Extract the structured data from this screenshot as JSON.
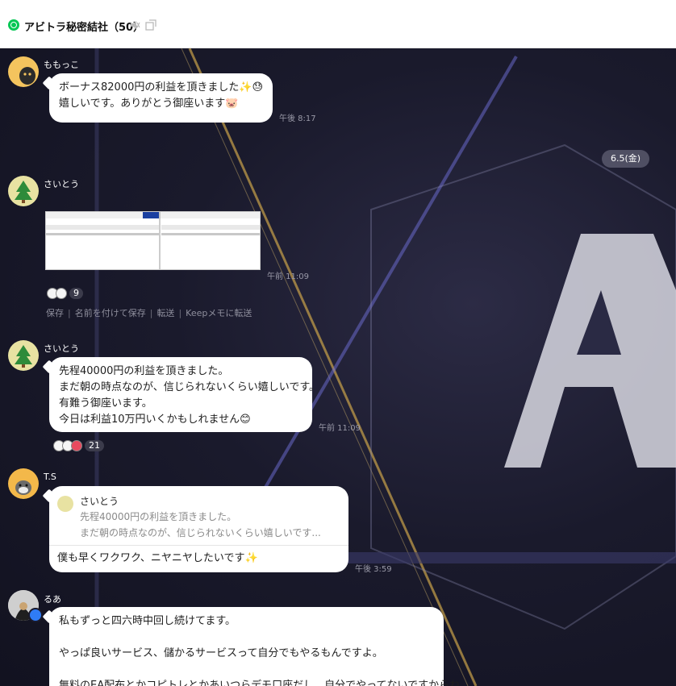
{
  "header": {
    "title": "アビトラ秘密結社（50）"
  },
  "date_separator": "6.5(金)",
  "messages": [
    {
      "sender": "ももっこ",
      "lines": [
        "ボーナス82000円の利益を頂きました✨😓",
        "嬉しいです。ありがとう御座います🐷"
      ],
      "time": "午後 8:17"
    },
    {
      "sender": "さいとう",
      "type": "image",
      "time": "午前 11:09",
      "reaction_count": "9",
      "actions": [
        "保存",
        "名前を付けて保存",
        "転送",
        "Keepメモに転送"
      ]
    },
    {
      "sender": "さいとう",
      "lines": [
        "先程40000円の利益を頂きました。",
        "まだ朝の時点なのが、信じられないくらい嬉しいです。",
        "有難う御座います。",
        "今日は利益10万円いくかもしれません😊"
      ],
      "time": "午前 11:09",
      "reaction_count": "21"
    },
    {
      "sender": "T.S",
      "reply_to": {
        "name": "さいとう",
        "line1": "先程40000円の利益を頂きました。",
        "line2": "まだ朝の時点なのが、信じられないくらい嬉しいです..."
      },
      "lines": [
        "僕も早くワクワク、ニヤニヤしたいです✨"
      ],
      "time": "午後 3:59"
    },
    {
      "sender": "るあ",
      "lines": [
        "私もずっと四六時中回し続けてます。",
        "",
        "やっぱ良いサービス、儲かるサービスって自分でもやるもんですよ。",
        "",
        "無料のEA配布とかコピトレとかあいつらデモ口座だし、自分でやってないですからね"
      ]
    }
  ],
  "colors": {
    "accent": "#06c755",
    "bubble": "#ffffff",
    "background": "#1a1a2c",
    "crown_badge": "#2f7cf6"
  },
  "icons": [
    "chat-room-icon",
    "mute-icon",
    "popout-icon",
    "crown-badge-icon"
  ]
}
